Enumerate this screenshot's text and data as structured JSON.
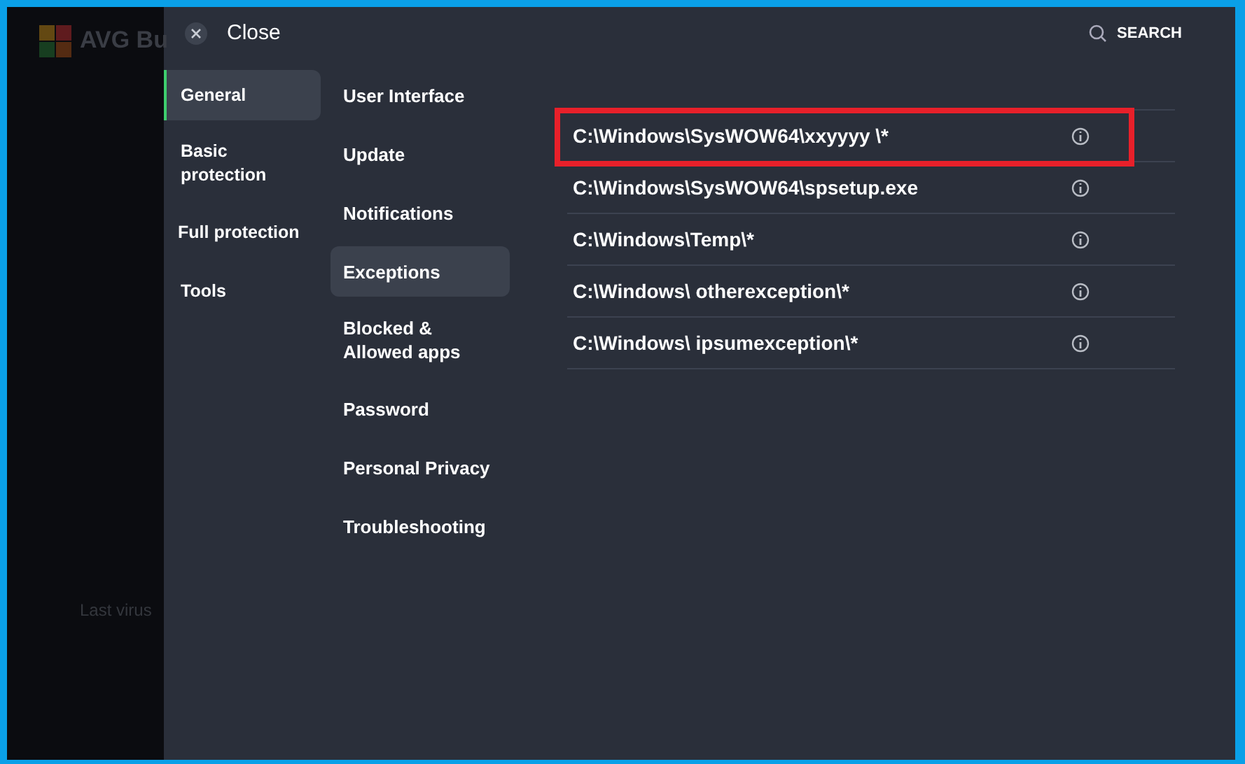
{
  "background_app": {
    "logo_text": "AVG Bu",
    "status_text": "Last virus"
  },
  "header": {
    "close_label": "Close",
    "search_label": "SEARCH"
  },
  "categories": [
    {
      "label": "General",
      "selected": true
    },
    {
      "label": "Basic protection",
      "selected": false
    },
    {
      "label": "Full protection",
      "selected": false
    },
    {
      "label": "Tools",
      "selected": false
    }
  ],
  "subcategories": [
    {
      "label": "User Interface",
      "selected": false
    },
    {
      "label": "Update",
      "selected": false
    },
    {
      "label": "Notifications",
      "selected": false
    },
    {
      "label": "Exceptions",
      "selected": true
    },
    {
      "label": "Blocked & Allowed apps",
      "selected": false
    },
    {
      "label": "Password",
      "selected": false
    },
    {
      "label": "Personal Privacy",
      "selected": false
    },
    {
      "label": "Troubleshooting",
      "selected": false
    }
  ],
  "exceptions": [
    {
      "path": "C:\\Windows\\SysWOW64\\xxyyyy \\*",
      "highlighted": true
    },
    {
      "path": "C:\\Windows\\SysWOW64\\spsetup.exe",
      "highlighted": false
    },
    {
      "path": "C:\\Windows\\Temp\\*",
      "highlighted": false
    },
    {
      "path": "C:\\Windows\\ otherexception\\*",
      "highlighted": false
    },
    {
      "path": "C:\\Windows\\ ipsumexception\\*",
      "highlighted": false
    }
  ]
}
